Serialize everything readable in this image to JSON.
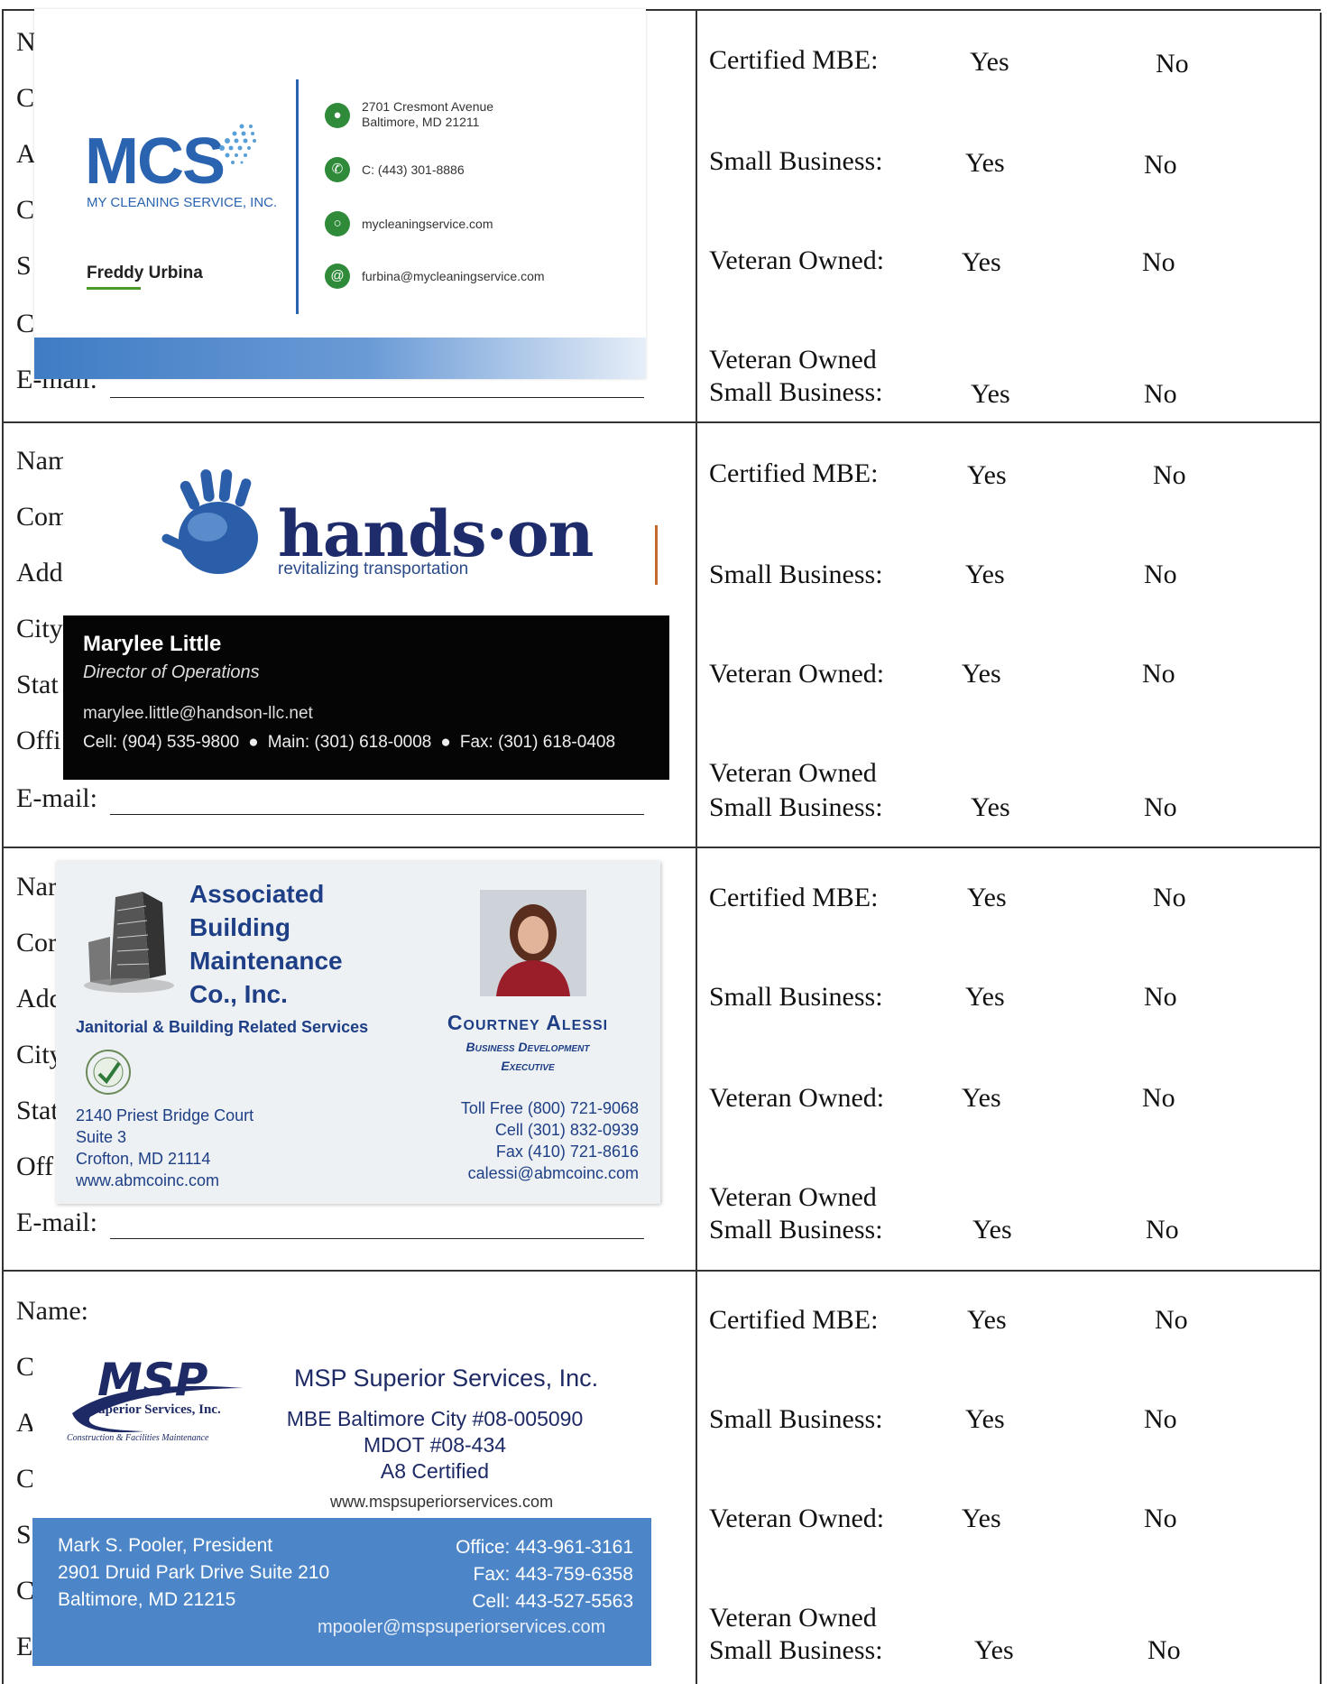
{
  "form": {
    "left_labels": {
      "block1": [
        "N",
        "C",
        "A",
        "C",
        "S",
        "C",
        "E-mail:"
      ],
      "block2": [
        "Nam",
        "Com",
        "Add",
        "City",
        "Stat",
        "Offi",
        "E-mail:"
      ],
      "block3": [
        "Nar",
        "Cor",
        "Add",
        "City",
        "Stat",
        "Off",
        "E-mail:"
      ],
      "block4": [
        "Name:",
        "C",
        "A",
        "C",
        "S",
        "C",
        "E"
      ]
    },
    "questions": {
      "certified_mbe": "Certified MBE:",
      "small_business": "Small Business:",
      "veteran_owned": "Veteran Owned:",
      "vosb_line1": "Veteran Owned",
      "vosb_line2": "Small Business:",
      "yes": "Yes",
      "no": "No"
    }
  },
  "card_mcs": {
    "logo": "MCS",
    "subtitle": "MY CLEANING SERVICE, INC.",
    "contact_name": "Freddy Urbina",
    "address_line1": "2701 Cresmont Avenue",
    "address_line2": "Baltimore, MD 21211",
    "phone": "C: (443) 301-8886",
    "website": "mycleaningservice.com",
    "email": "furbina@mycleaningservice.com",
    "accent_color": "#2a63b0",
    "icon_color": "#2f8a3a",
    "icons": [
      "location-pin-icon",
      "phone-icon",
      "globe-icon",
      "at-sign-icon"
    ]
  },
  "card_handson": {
    "brand": "hands·on",
    "tagline": "revitalizing transportation",
    "contact_name": "Marylee Little",
    "title": "Director of Operations",
    "email": "marylee.little@handson-llc.net",
    "cell": "Cell: (904) 535-9800",
    "main": "Main: (301) 618-0008",
    "fax": "Fax: (301) 618-0408",
    "brand_color": "#1f2c6b"
  },
  "card_associated": {
    "name_lines": [
      "Associated",
      "Building",
      "Maintenance",
      "Co., Inc."
    ],
    "services": "Janitorial & Building Related Services",
    "address": [
      "2140 Priest Bridge Court",
      "Suite 3",
      "Crofton, MD 21114",
      "www.abmcoinc.com"
    ],
    "contact_name": "Courtney Alessi",
    "role_lines": [
      "Business Development",
      "Executive"
    ],
    "toll_free": "Toll Free (800) 721-9068",
    "cell": "Cell (301) 832-0939",
    "fax": "Fax (410) 721-8616",
    "email": "calessi@abmcoinc.com",
    "brand_color": "#1e3f86"
  },
  "card_msp": {
    "logo": "MSP",
    "logo_sub": "Superior Services, Inc.",
    "logo_sub2": "Construction & Facilities Maintenance",
    "company": "MSP Superior Services, Inc.",
    "cert_lines": [
      "MBE Baltimore City #08-005090",
      "MDOT #08-434",
      "A8 Certified"
    ],
    "website": "www.mspsuperiorservices.com",
    "contact_name": "Mark S. Pooler, President",
    "address_line1": "2901 Druid Park Drive Suite 210",
    "address_line2": "Baltimore, MD 21215",
    "office": "Office: 443-961-3161",
    "fax": "Fax: 443-759-6358",
    "cell": "Cell: 443-527-5563",
    "email": "mpooler@mspsuperiorservices.com",
    "band_color": "#4c86c8"
  }
}
